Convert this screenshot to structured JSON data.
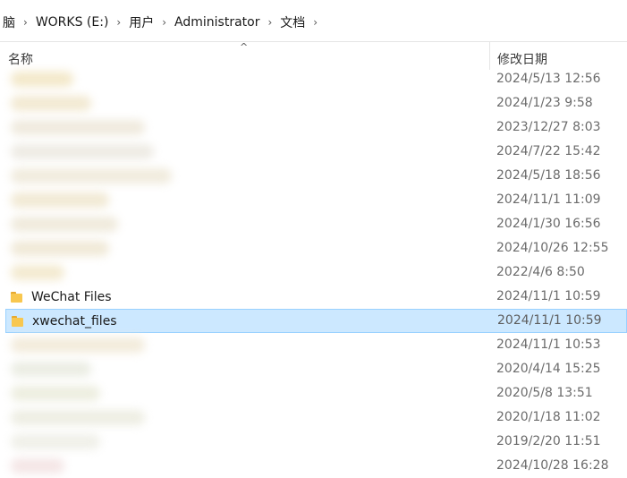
{
  "breadcrumb": {
    "items": [
      "脑",
      "WORKS (E:)",
      "用户",
      "Administrator",
      "文档"
    ],
    "separator": "›"
  },
  "columns": {
    "name": "名称",
    "date": "修改日期"
  },
  "rows": [
    {
      "name": "",
      "date": "2024/5/13 12:56",
      "blurred": true,
      "blur_color": "#f2e6c4",
      "blur_width": 70
    },
    {
      "name": "",
      "date": "2024/1/23 9:58",
      "blurred": true,
      "blur_color": "#f1e7cd",
      "blur_width": 90
    },
    {
      "name": "",
      "date": "2023/12/27 8:03",
      "blurred": true,
      "blur_color": "#eee8da",
      "blur_width": 150
    },
    {
      "name": "",
      "date": "2024/7/22 15:42",
      "blurred": true,
      "blur_color": "#ece9e1",
      "blur_width": 160
    },
    {
      "name": "",
      "date": "2024/5/18 18:56",
      "blurred": true,
      "blur_color": "#efe9d9",
      "blur_width": 180
    },
    {
      "name": "",
      "date": "2024/11/1 11:09",
      "blurred": true,
      "blur_color": "#f0e7cf",
      "blur_width": 110
    },
    {
      "name": "",
      "date": "2024/1/30 16:56",
      "blurred": true,
      "blur_color": "#eee8d8",
      "blur_width": 120
    },
    {
      "name": "",
      "date": "2024/10/26 12:55",
      "blurred": true,
      "blur_color": "#efe7d3",
      "blur_width": 110
    },
    {
      "name": "",
      "date": "2022/4/6 8:50",
      "blurred": true,
      "blur_color": "#f2e8cb",
      "blur_width": 60
    },
    {
      "name": "WeChat Files",
      "date": "2024/11/1 10:59",
      "blurred": false,
      "selected": false
    },
    {
      "name": "xwechat_files",
      "date": "2024/11/1 10:59",
      "blurred": false,
      "selected": true
    },
    {
      "name": "",
      "date": "2024/11/1 10:53",
      "blurred": true,
      "blur_color": "#f1e9d7",
      "blur_width": 150
    },
    {
      "name": "",
      "date": "2020/4/14 15:25",
      "blurred": true,
      "blur_color": "#e9ebe0",
      "blur_width": 90
    },
    {
      "name": "",
      "date": "2020/5/8 13:51",
      "blurred": true,
      "blur_color": "#ebecdc",
      "blur_width": 100
    },
    {
      "name": "",
      "date": "2020/1/18 11:02",
      "blurred": true,
      "blur_color": "#ecece0",
      "blur_width": 150
    },
    {
      "name": "",
      "date": "2019/2/20 11:51",
      "blurred": true,
      "blur_color": "#eeeee6",
      "blur_width": 100
    },
    {
      "name": "",
      "date": "2024/10/28 16:28",
      "blurred": true,
      "blur_color": "#f3e3e3",
      "blur_width": 60
    }
  ],
  "colors": {
    "selection_bg": "#cce8ff",
    "selection_border": "#99d1ff",
    "folder": "#f8c74f"
  },
  "icons": {
    "folder": "folder-icon",
    "sort": "sort-up-icon"
  }
}
